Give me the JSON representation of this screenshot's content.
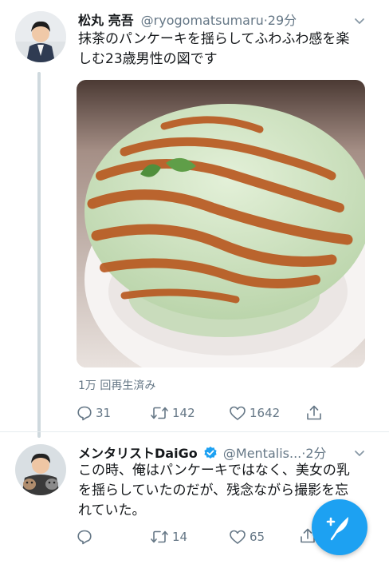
{
  "tweet1": {
    "name": "松丸 亮吾",
    "handle": "@ryogomatsumaru",
    "time": "29分",
    "text_lines": [
      "抹茶のパンケーキを揺らしてふわふわ感を楽",
      "しむ23歳男性の図です"
    ],
    "views": "1万 回再生済み",
    "replies": "31",
    "retweets": "142",
    "likes": "1642"
  },
  "tweet2": {
    "name": "メンタリストDaiGo",
    "handle": "@Mentalis...",
    "time": "2分",
    "text_lines": [
      "この時、俺はパンケーキではなく、美女の乳",
      "を揺らしていたのだが、残念ながら撮影を忘",
      "れていた。"
    ],
    "retweets": "14",
    "likes": "65"
  },
  "icons": {
    "reply": "reply-icon",
    "retweet": "retweet-icon",
    "like": "heart-icon",
    "share": "share-icon",
    "chevron": "chevron-down-icon",
    "verified": "verified-badge-icon",
    "compose": "compose-tweet-icon"
  },
  "colors": {
    "accent": "#1da1f2",
    "secondary_text": "#657786",
    "thread_line": "#cfd9de"
  }
}
